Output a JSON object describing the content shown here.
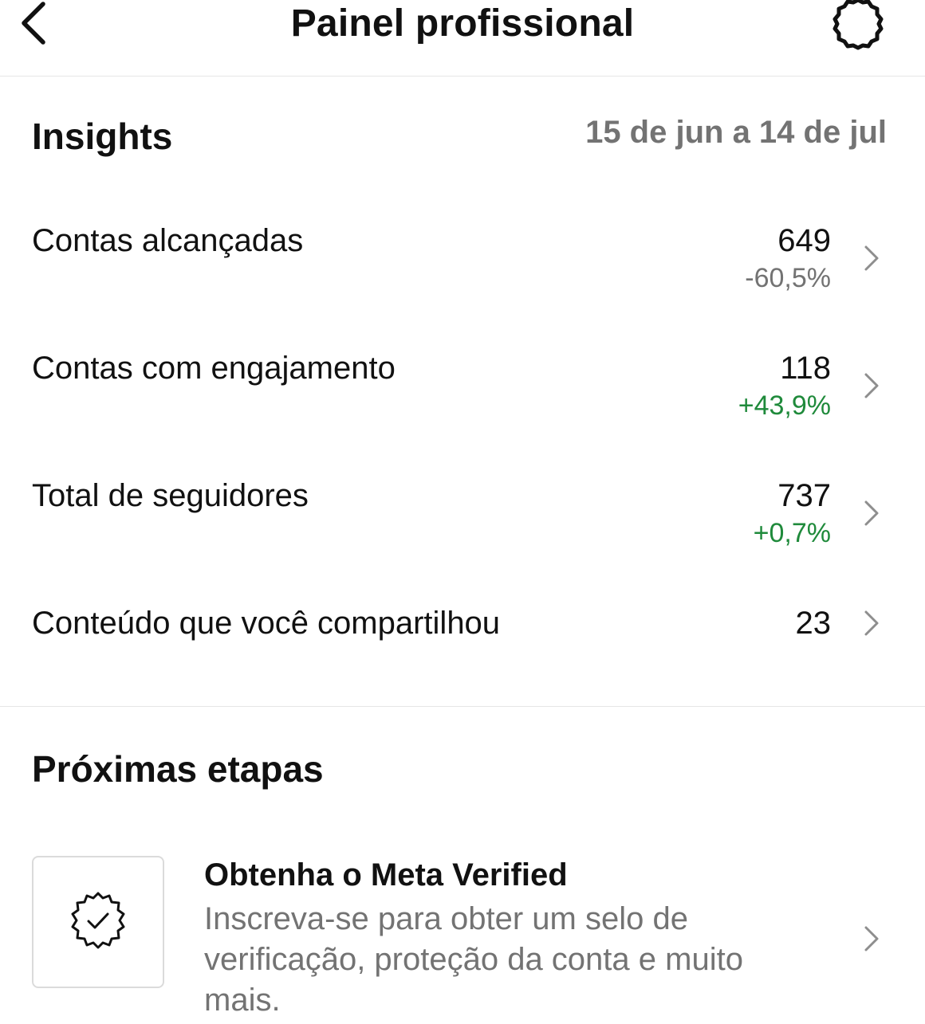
{
  "header": {
    "title": "Painel profissional",
    "back_icon": "chevron-left-icon",
    "settings_icon": "gear-icon"
  },
  "insights": {
    "title": "Insights",
    "date_range": "15 de jun a 14 de jul",
    "metrics": [
      {
        "label": "Contas alcançadas",
        "value": "649",
        "change": "-60,5%",
        "trend": "negative"
      },
      {
        "label": "Contas com engajamento",
        "value": "118",
        "change": "+43,9%",
        "trend": "positive"
      },
      {
        "label": "Total de seguidores",
        "value": "737",
        "change": "+0,7%",
        "trend": "positive"
      },
      {
        "label": "Conteúdo que você compartilhou",
        "value": "23",
        "change": "",
        "trend": "none"
      }
    ]
  },
  "next_steps": {
    "title": "Próximas etapas",
    "items": [
      {
        "icon": "verified-badge-icon",
        "title": "Obtenha o Meta Verified",
        "description": "Inscreva-se para obter um selo de verificação, proteção da conta e muito mais."
      }
    ]
  },
  "colors": {
    "text_primary": "#111111",
    "text_secondary": "#737373",
    "positive": "#1f8a3b",
    "negative": "#737373",
    "divider": "#e6e6e6"
  }
}
